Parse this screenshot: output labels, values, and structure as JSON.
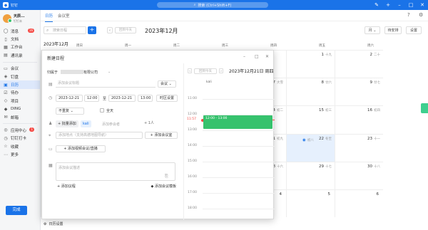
{
  "app": {
    "title": "钉钉",
    "search_placeholder": "搜索 (Ctrl+Shift+F)"
  },
  "profile": {
    "name": "天辰...",
    "status": "钉钉未"
  },
  "sidebar": {
    "items": [
      {
        "label": "消息",
        "icon": "chat-icon",
        "badge": "16"
      },
      {
        "label": "文档",
        "icon": "doc-icon"
      },
      {
        "label": "工作台",
        "icon": "grid-icon"
      },
      {
        "label": "通讯录",
        "icon": "contacts-icon"
      },
      {
        "label": "会议",
        "icon": "video-icon"
      },
      {
        "label": "钉盘",
        "icon": "drive-icon"
      },
      {
        "label": "日历",
        "icon": "calendar-icon",
        "active": true
      },
      {
        "label": "待办",
        "icon": "todo-icon"
      },
      {
        "label": "项目",
        "icon": "project-icon"
      },
      {
        "label": "DING",
        "icon": "ding-icon"
      },
      {
        "label": "邮箱",
        "icon": "mail-icon"
      },
      {
        "label": "应用中心",
        "icon": "apps-icon",
        "badge": "1"
      },
      {
        "label": "钉钉打卡",
        "icon": "clock-icon"
      },
      {
        "label": "收藏",
        "icon": "star-icon"
      },
      {
        "label": "更多",
        "icon": "more-icon"
      }
    ]
  },
  "calendar": {
    "tabs": [
      "日历",
      "会议室"
    ],
    "search_placeholder": "搜索日程",
    "today_label": "回到今天",
    "month_title": "2023年12月",
    "view": "月",
    "filter": "待安排",
    "new_btn": "设置",
    "weekdays": [
      "周日",
      "周一",
      "周二",
      "周三",
      "周四",
      "周五",
      "周六"
    ],
    "settings_label": "日历设置",
    "rows": [
      [
        "",
        "",
        "",
        "",
        "",
        {
          "n": "1",
          "l": "十九"
        },
        {
          "n": "2",
          "l": "二十"
        }
      ],
      [
        "",
        "",
        "",
        "",
        {
          "n": "7",
          "l": "大雪"
        },
        {
          "n": "8",
          "l": "廿六"
        },
        {
          "n": "9",
          "l": "廿七"
        }
      ],
      [
        "",
        "",
        "",
        "",
        {
          "n": "14",
          "l": "初二"
        },
        {
          "n": "15",
          "l": "初三"
        },
        {
          "n": "16",
          "l": "初四"
        }
      ],
      [
        "",
        "",
        "",
        "",
        {
          "n": "21",
          "l": "初九"
        },
        {
          "n": "22",
          "l": "冬至"
        },
        {
          "n": "23",
          "l": "十一"
        }
      ],
      [
        "",
        "",
        "",
        "",
        {
          "n": "28",
          "l": "十六"
        },
        {
          "n": "29",
          "l": "十七"
        },
        {
          "n": "30",
          "l": "十八"
        }
      ],
      [
        "",
        "",
        "",
        "",
        {
          "n": "4",
          "l": ""
        },
        {
          "n": "5",
          "l": ""
        },
        {
          "n": "6",
          "l": ""
        }
      ]
    ],
    "today_cell": "初八"
  },
  "dialog": {
    "title": "新建日程",
    "owner_prefix": "归属于",
    "owner_company": "有限公司",
    "title_placeholder": "添加会议标题",
    "type": "会议",
    "start_date": "2023-12-21",
    "start_time": "12:00",
    "to": "至",
    "end_date": "2023-12-21",
    "end_time": "13:00",
    "timezone_btn": "时区设置",
    "repeat": "不重复",
    "allday": "全天",
    "batch_add": "批量添加",
    "attendee": "kali",
    "attendee_placeholder": "添加参会者",
    "attendee_count": "1人",
    "location_placeholder": "添加地点（支持高德地图导航）",
    "room_btn": "添加会议室",
    "video_btn": "添加视频会议/直播",
    "desc_placeholder": "添加会议描述",
    "agenda_btn": "添加议程",
    "template_btn": "添加会议模板",
    "done": "完成",
    "right": {
      "today_label": "回到今天",
      "date": "2023年12月21日 周四",
      "attendee": "kali",
      "hours": [
        "11:00",
        "12:00",
        "13:00",
        "14:00",
        "15:00",
        "16:00",
        "17:00",
        "18:00"
      ],
      "now_time": "11:57",
      "event_label": "12:00 - 13:00"
    }
  },
  "colors": {
    "accent": "#1a73e8",
    "event": "#36c26d",
    "now": "#f54a45"
  }
}
